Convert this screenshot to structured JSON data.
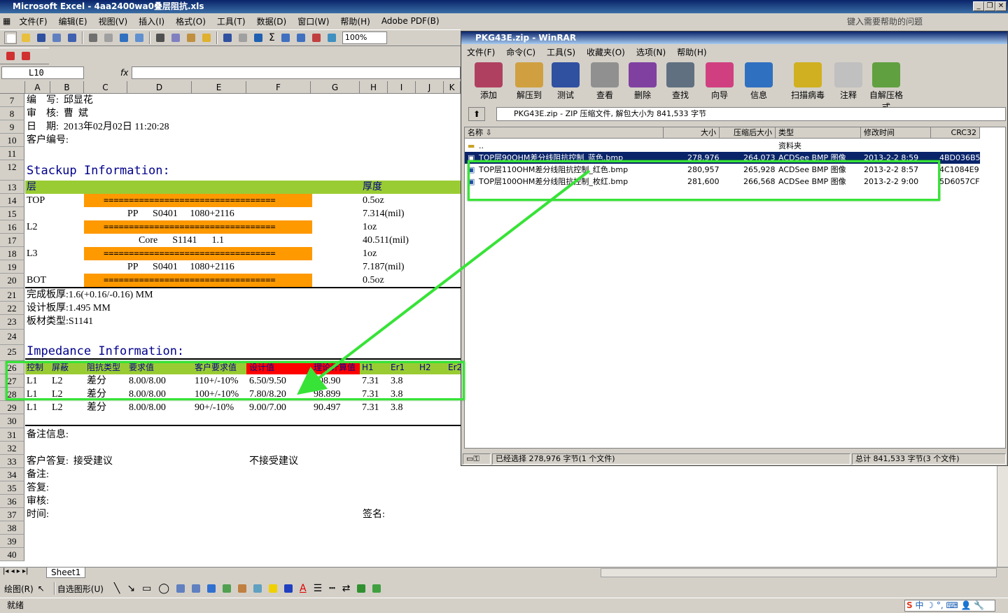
{
  "excel": {
    "title": "Microsoft Excel - 4aa2400wa0叠层阻抗.xls",
    "help_placeholder": "键入需要帮助的问题",
    "menus": [
      "文件(F)",
      "编辑(E)",
      "视图(V)",
      "插入(I)",
      "格式(O)",
      "工具(T)",
      "数据(D)",
      "窗口(W)",
      "帮助(H)",
      "Adobe PDF(B)"
    ],
    "zoom": "100%",
    "name_box": "L10",
    "fx": "fx",
    "columns": [
      "A",
      "B",
      "C",
      "D",
      "E",
      "F",
      "G",
      "H",
      "I",
      "J",
      "K"
    ],
    "rows": [
      "7",
      "8",
      "9",
      "10",
      "11",
      "12",
      "13",
      "14",
      "15",
      "16",
      "17",
      "18",
      "19",
      "20",
      "21",
      "22",
      "23",
      "24",
      "25",
      "26",
      "27",
      "28",
      "29",
      "30",
      "31",
      "32",
      "33",
      "34",
      "35",
      "36",
      "37",
      "38",
      "39",
      "40"
    ],
    "cells": {
      "r7": "编    写:  邱显花",
      "r8": "审    核:  曹  斌",
      "r9": "日    期:  2013年02月02日 11:20:28",
      "r10": "客户编号:",
      "r12": "Stackup Information:",
      "r13a": "层",
      "r13b": "厚度",
      "r14a": "TOP",
      "r14h": "0.5oz",
      "r15": "PP      S0401     1080+2116",
      "r15h": "7.314(mil)",
      "r16a": "L2",
      "r16h": "1oz",
      "r17": "Core      S1141      1.1",
      "r17h": "40.511(mil)",
      "r18a": "L3",
      "r18h": "1oz",
      "r19": "PP      S0401     1080+2116",
      "r19h": "7.187(mil)",
      "r20a": "BOT",
      "r20h": "0.5oz",
      "r21": "完成板厚:1.6(+0.16/-0.16) MM",
      "r22": "设计板厚:1.495 MM",
      "r23": "板材类型:S1141",
      "r25": "Impedance Information:",
      "r33a": "客户答复:  接受建议",
      "r33b": "不接受建议",
      "r31": "备注信息:",
      "r34": "备注:",
      "r35": "答复:",
      "r36": "审核:",
      "r37a": "时间:",
      "r37b": "签名:",
      "layer_line": "=================================="
    },
    "imp_header": [
      "控制",
      "屏蔽",
      "阻抗类型",
      "要求值",
      "客户要求值",
      "设计值",
      "理论计算值",
      "H1",
      "Er1",
      "H2",
      "Er2"
    ],
    "imp_rows": [
      [
        "L1",
        "L2",
        "差分",
        "8.00/8.00",
        "110+/-10%",
        "6.50/9.50",
        "108.90",
        "7.31",
        "3.8"
      ],
      [
        "L1",
        "L2",
        "差分",
        "8.00/8.00",
        "100+/-10%",
        "7.80/8.20",
        "98.899",
        "7.31",
        "3.8"
      ],
      [
        "L1",
        "L2",
        "差分",
        "8.00/8.00",
        "90+/-10%",
        "9.00/7.00",
        "90.497",
        "7.31",
        "3.8"
      ]
    ],
    "sheet_tab": "Sheet1",
    "status": "就绪",
    "draw_label": "绘图(R)",
    "autoshape_label": "自选图形(U)"
  },
  "rar": {
    "title": "PKG43E.zip - WinRAR",
    "menus": [
      "文件(F)",
      "命令(C)",
      "工具(S)",
      "收藏夹(O)",
      "选项(N)",
      "帮助(H)"
    ],
    "buttons": [
      "添加",
      "解压到",
      "测试",
      "查看",
      "删除",
      "查找",
      "向导",
      "信息",
      "扫描病毒",
      "注释",
      "自解压格式"
    ],
    "path": "PKG43E.zip - ZIP 压缩文件, 解包大小为 841,533 字节",
    "headers": [
      "名称",
      "大小",
      "压缩后大小",
      "类型",
      "修改时间",
      "CRC32"
    ],
    "parent_row": {
      "name": "..",
      "type": "资料夹"
    },
    "files": [
      {
        "name": "TOP层90OHM差分线阻抗控制_蓝色.bmp",
        "size": "278,976",
        "packed": "264,073",
        "type": "ACDSee BMP 图像",
        "time": "2013-2-2 8:59",
        "crc": "4BD036B5"
      },
      {
        "name": "TOP层110OHM差分线阻抗控制_红色.bmp",
        "size": "280,957",
        "packed": "265,928",
        "type": "ACDSee BMP 图像",
        "time": "2013-2-2 8:57",
        "crc": "4C1084E9"
      },
      {
        "name": "TOP层100OHM差分线阻抗控制_枚红.bmp",
        "size": "281,600",
        "packed": "266,568",
        "type": "ACDSee BMP 图像",
        "time": "2013-2-2 9:00",
        "crc": "5D6057CF"
      }
    ],
    "status_left": "已经选择 278,976 字节(1 个文件)",
    "status_right": "总计 841,533 字节(3 个文件)"
  },
  "colors": {
    "green_band": "#99cc33",
    "orange": "#ff9900",
    "red": "#ff0000",
    "annot": "#37e337"
  }
}
